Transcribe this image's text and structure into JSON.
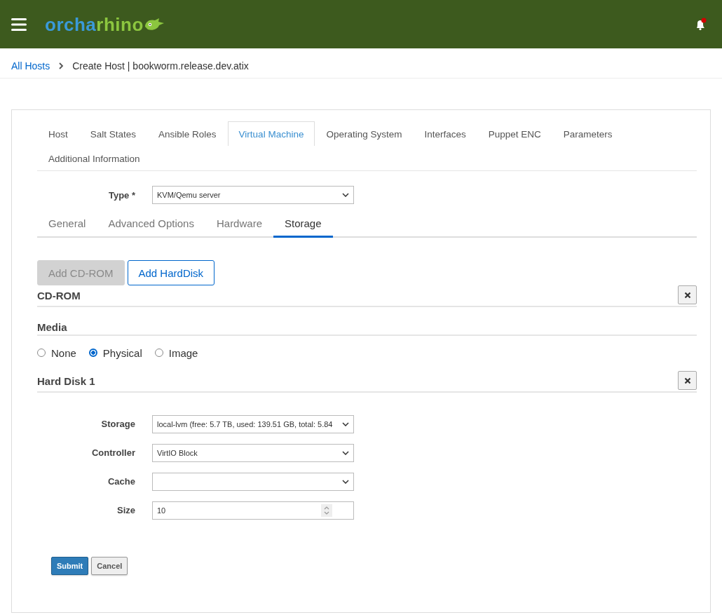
{
  "header": {
    "logo_parts": [
      "orcha",
      "rhino"
    ],
    "notification_unread": true
  },
  "breadcrumb": {
    "items": [
      "All Hosts",
      "Create Host | bookworm.release.dev.atix"
    ]
  },
  "tabs": [
    {
      "label": "Host",
      "selected": false
    },
    {
      "label": "Salt States",
      "selected": false
    },
    {
      "label": "Ansible Roles",
      "selected": false
    },
    {
      "label": "Virtual Machine",
      "selected": true
    },
    {
      "label": "Operating System",
      "selected": false
    },
    {
      "label": "Interfaces",
      "selected": false
    },
    {
      "label": "Puppet ENC",
      "selected": false
    },
    {
      "label": "Parameters",
      "selected": false
    },
    {
      "label": "Additional Information",
      "selected": false
    }
  ],
  "type_field": {
    "label": "Type *",
    "value": "KVM/Qemu server"
  },
  "subtabs": [
    {
      "label": "General",
      "selected": false
    },
    {
      "label": "Advanced Options",
      "selected": false
    },
    {
      "label": "Hardware",
      "selected": false
    },
    {
      "label": "Storage",
      "selected": true
    }
  ],
  "add_buttons": [
    {
      "label": "Add CD-ROM",
      "disabled": true
    },
    {
      "label": "Add HardDisk",
      "disabled": false
    }
  ],
  "cdrom": {
    "title": "CD-ROM",
    "media_title": "Media",
    "media_options": [
      {
        "label": "None",
        "selected": false
      },
      {
        "label": "Physical",
        "selected": true
      },
      {
        "label": "Image",
        "selected": false
      }
    ]
  },
  "hard_disk": {
    "title": "Hard Disk 1",
    "fields": [
      {
        "kind": "select",
        "label": "Storage",
        "value": "local-lvm (free: 5.7 TB, used: 139.51 GB, total: 5.84"
      },
      {
        "kind": "select",
        "label": "Controller",
        "value": "VirtIO Block"
      },
      {
        "kind": "select",
        "label": "Cache"
      },
      {
        "kind": "number",
        "label": "Size",
        "value": "10"
      }
    ]
  },
  "actions": [
    {
      "kind": "primary",
      "label": "Submit"
    },
    {
      "kind": "default",
      "label": "Cancel"
    }
  ]
}
